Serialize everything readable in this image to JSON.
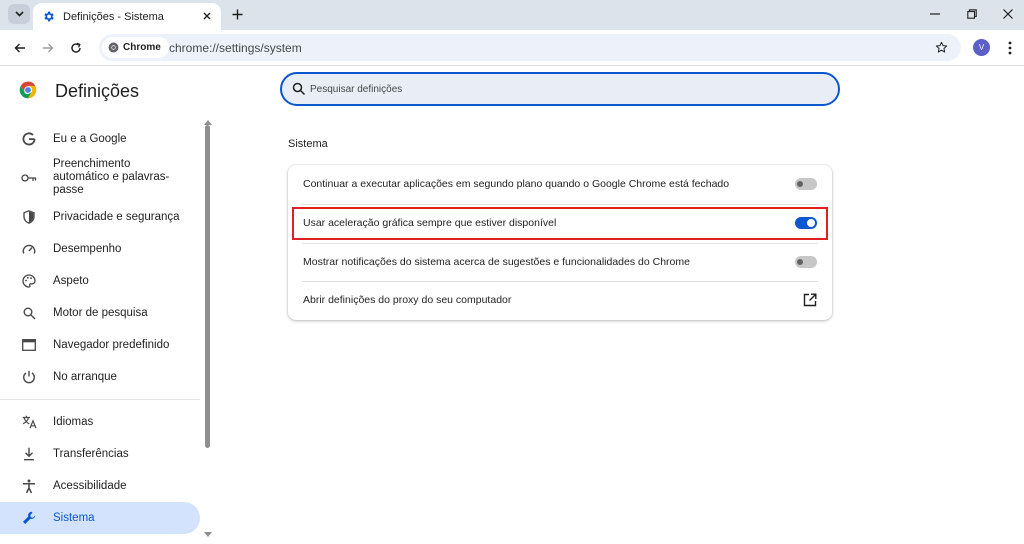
{
  "browser": {
    "tab": {
      "title": "Definições - Sistema"
    },
    "omnibox": {
      "chip_label": "Chrome",
      "url": "chrome://settings/system"
    },
    "avatar_initial": "V",
    "colors": {
      "accent": "#0b57d0",
      "tabstrip": "#dde3ea",
      "omnibox_bg": "#edf2fa",
      "highlight": "#e02020"
    }
  },
  "settings": {
    "title": "Definições",
    "search_placeholder": "Pesquisar definições",
    "sidebar": {
      "items": [
        {
          "label": "Eu e a Google",
          "icon": "google-g-icon"
        },
        {
          "label": "Preenchimento automático e palavras-passe",
          "icon": "key-icon"
        },
        {
          "label": "Privacidade e segurança",
          "icon": "shield-icon"
        },
        {
          "label": "Desempenho",
          "icon": "speedometer-icon"
        },
        {
          "label": "Aspeto",
          "icon": "palette-icon"
        },
        {
          "label": "Motor de pesquisa",
          "icon": "search-icon"
        },
        {
          "label": "Navegador predefinido",
          "icon": "browser-window-icon"
        },
        {
          "label": "No arranque",
          "icon": "power-icon"
        },
        {
          "label": "Idiomas",
          "icon": "translate-icon"
        },
        {
          "label": "Transferências",
          "icon": "download-icon"
        },
        {
          "label": "Acessibilidade",
          "icon": "accessibility-icon"
        },
        {
          "label": "Sistema",
          "icon": "wrench-icon",
          "active": true
        }
      ]
    },
    "section_title": "Sistema",
    "rows": [
      {
        "label": "Continuar a executar aplicações em segundo plano quando o Google Chrome está fechado",
        "control": "toggle",
        "enabled": false
      },
      {
        "label": "Usar aceleração gráfica sempre que estiver disponível",
        "control": "toggle",
        "enabled": true,
        "highlighted": true
      },
      {
        "label": "Mostrar notificações do sistema acerca de sugestões e funcionalidades do Chrome",
        "control": "toggle",
        "enabled": false
      },
      {
        "label": "Abrir definições do proxy do seu computador",
        "control": "external-link",
        "icon": "open-in-new-icon"
      }
    ]
  }
}
